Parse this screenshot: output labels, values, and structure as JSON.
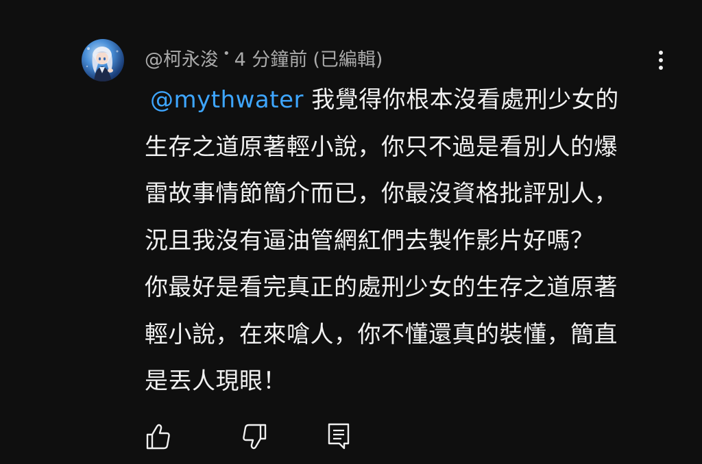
{
  "comment": {
    "author": "@柯永浚",
    "separator": "•",
    "time": "4 分鐘前",
    "edited": "(已編輯)",
    "mention": "@mythwater",
    "first_line_rest": " 我覺得你根本沒看處刑少女的",
    "lines": [
      "生存之道原著輕小說，你只不過是看別人的爆",
      "雷故事情節簡介而已，你最沒資格批評別人，",
      "況且我沒有逼油管網紅們去製作影片好嗎？",
      "你最好是看完真正的處刑少女的生存之道原著",
      "輕小說，在來嗆人，你不懂還真的裝懂，簡直",
      "是丟人現眼！"
    ]
  },
  "icons": {
    "avatar": "anime-character-avatar",
    "more": "more-vertical-icon",
    "like": "thumbs-up-icon",
    "dislike": "thumbs-down-icon",
    "reply": "reply-comment-icon"
  },
  "colors": {
    "background": "#0f0f0f",
    "text": "#f1f1f1",
    "meta": "#aaaaaa",
    "mention": "#3ea6ff"
  }
}
